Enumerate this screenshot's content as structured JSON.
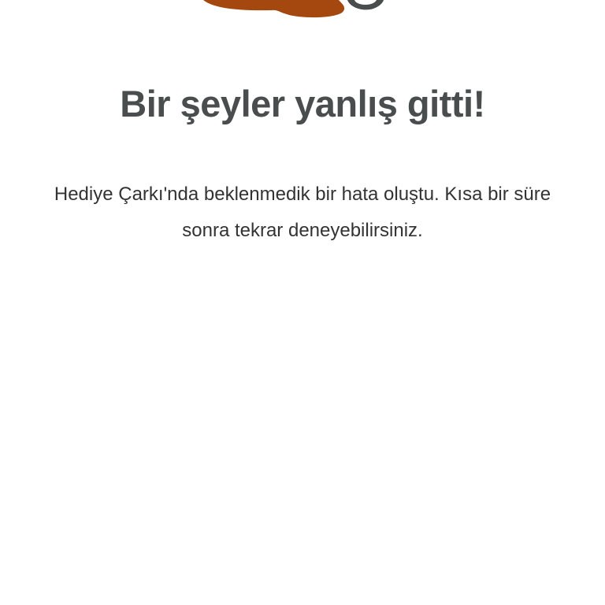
{
  "error_page": {
    "illustration_icon": "broken-wheel-illustration",
    "title": "Bir şeyler yanlış gitti!",
    "message": "Hediye Çarkı'nda beklenmedik bir hata oluştu. Kısa bir süre sonra tekrar deneyebilirsiniz."
  },
  "colors": {
    "background": "#ffffff",
    "title": "#4a4d4e",
    "body_text": "#333333",
    "puddle": "#a4480f",
    "wheel": "#4a4d4e"
  }
}
